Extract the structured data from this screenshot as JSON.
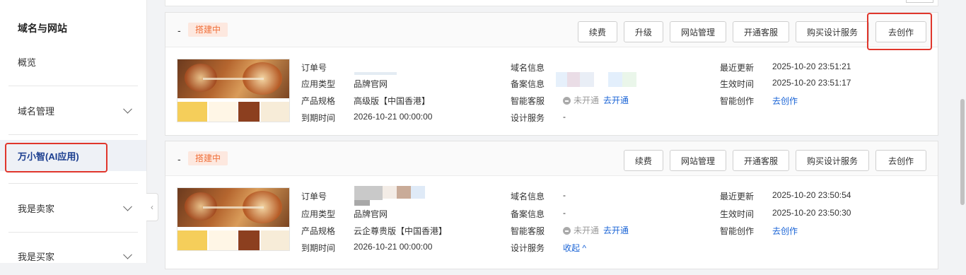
{
  "sidebar": {
    "title": "域名与网站",
    "items": [
      {
        "label": "概览",
        "expandable": false
      },
      {
        "label": "域名管理",
        "expandable": true
      },
      {
        "label": "万小智(AI应用)",
        "expandable": false,
        "active": true
      },
      {
        "label": "我是卖家",
        "expandable": true
      },
      {
        "label": "我是买家",
        "expandable": true
      }
    ],
    "collapse_icon": "chevron-left-icon"
  },
  "labels": {
    "order_no": "订单号",
    "app_type": "应用类型",
    "spec": "产品规格",
    "expire": "到期时间",
    "domain": "域名信息",
    "icp": "备案信息",
    "smart_cs": "智能客服",
    "design": "设计服务",
    "updated": "最近更新",
    "effective": "生效时间",
    "smart_create": "智能创作"
  },
  "cards": [
    {
      "dash": "-",
      "status": "搭建中",
      "buttons": [
        "续费",
        "升级",
        "网站管理",
        "开通客服",
        "购买设计服务",
        "去创作"
      ],
      "app_type": "品牌官网",
      "spec": "高级版【中国香港】",
      "expire": "2026-10-21 00:00:00",
      "smart_cs_status": "未开通",
      "smart_cs_link": "去开通",
      "design": "-",
      "updated": "2025-10-20 23:51:21",
      "effective": "2025-10-20 23:51:17",
      "smart_create_link": "去创作"
    },
    {
      "dash": "-",
      "status": "搭建中",
      "buttons": [
        "续费",
        "网站管理",
        "开通客服",
        "购买设计服务",
        "去创作"
      ],
      "app_type": "品牌官网",
      "spec": "云企尊贵版【中国香港】",
      "expire": "2026-10-21 00:00:00",
      "domain": "-",
      "icp": "-",
      "smart_cs_status": "未开通",
      "smart_cs_link": "去开通",
      "design_link": "收起 ^",
      "updated": "2025-10-20 23:50:54",
      "effective": "2025-10-20 23:50:30",
      "smart_create_link": "去创作"
    }
  ],
  "colors": {
    "status_bg": "#fde8df",
    "status_text": "#f0703a",
    "link": "#1a64d6",
    "highlight": "#e0362c"
  }
}
